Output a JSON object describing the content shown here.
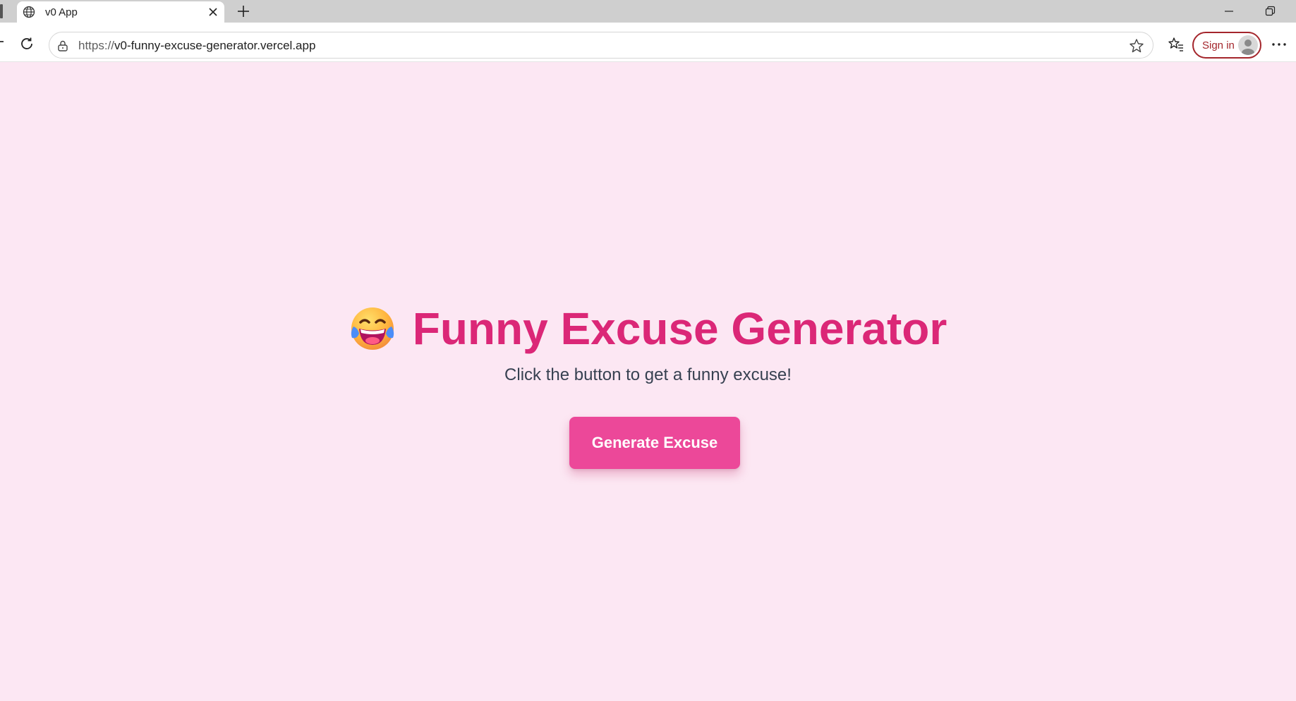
{
  "browser": {
    "tab": {
      "title": "v0 App",
      "icon": "globe-icon"
    },
    "url": {
      "scheme": "https://",
      "rest": "v0-funny-excuse-generator.vercel.app"
    },
    "signin_label": "Sign in"
  },
  "page": {
    "emoji": "face-with-tears-of-joy",
    "title": "Funny Excuse Generator",
    "subtitle": "Click the button to get a funny excuse!",
    "button_label": "Generate Excuse"
  },
  "colors": {
    "background": "#fce7f3",
    "title": "#db2777",
    "button": "#ec4899",
    "signin": "#a4262c"
  }
}
